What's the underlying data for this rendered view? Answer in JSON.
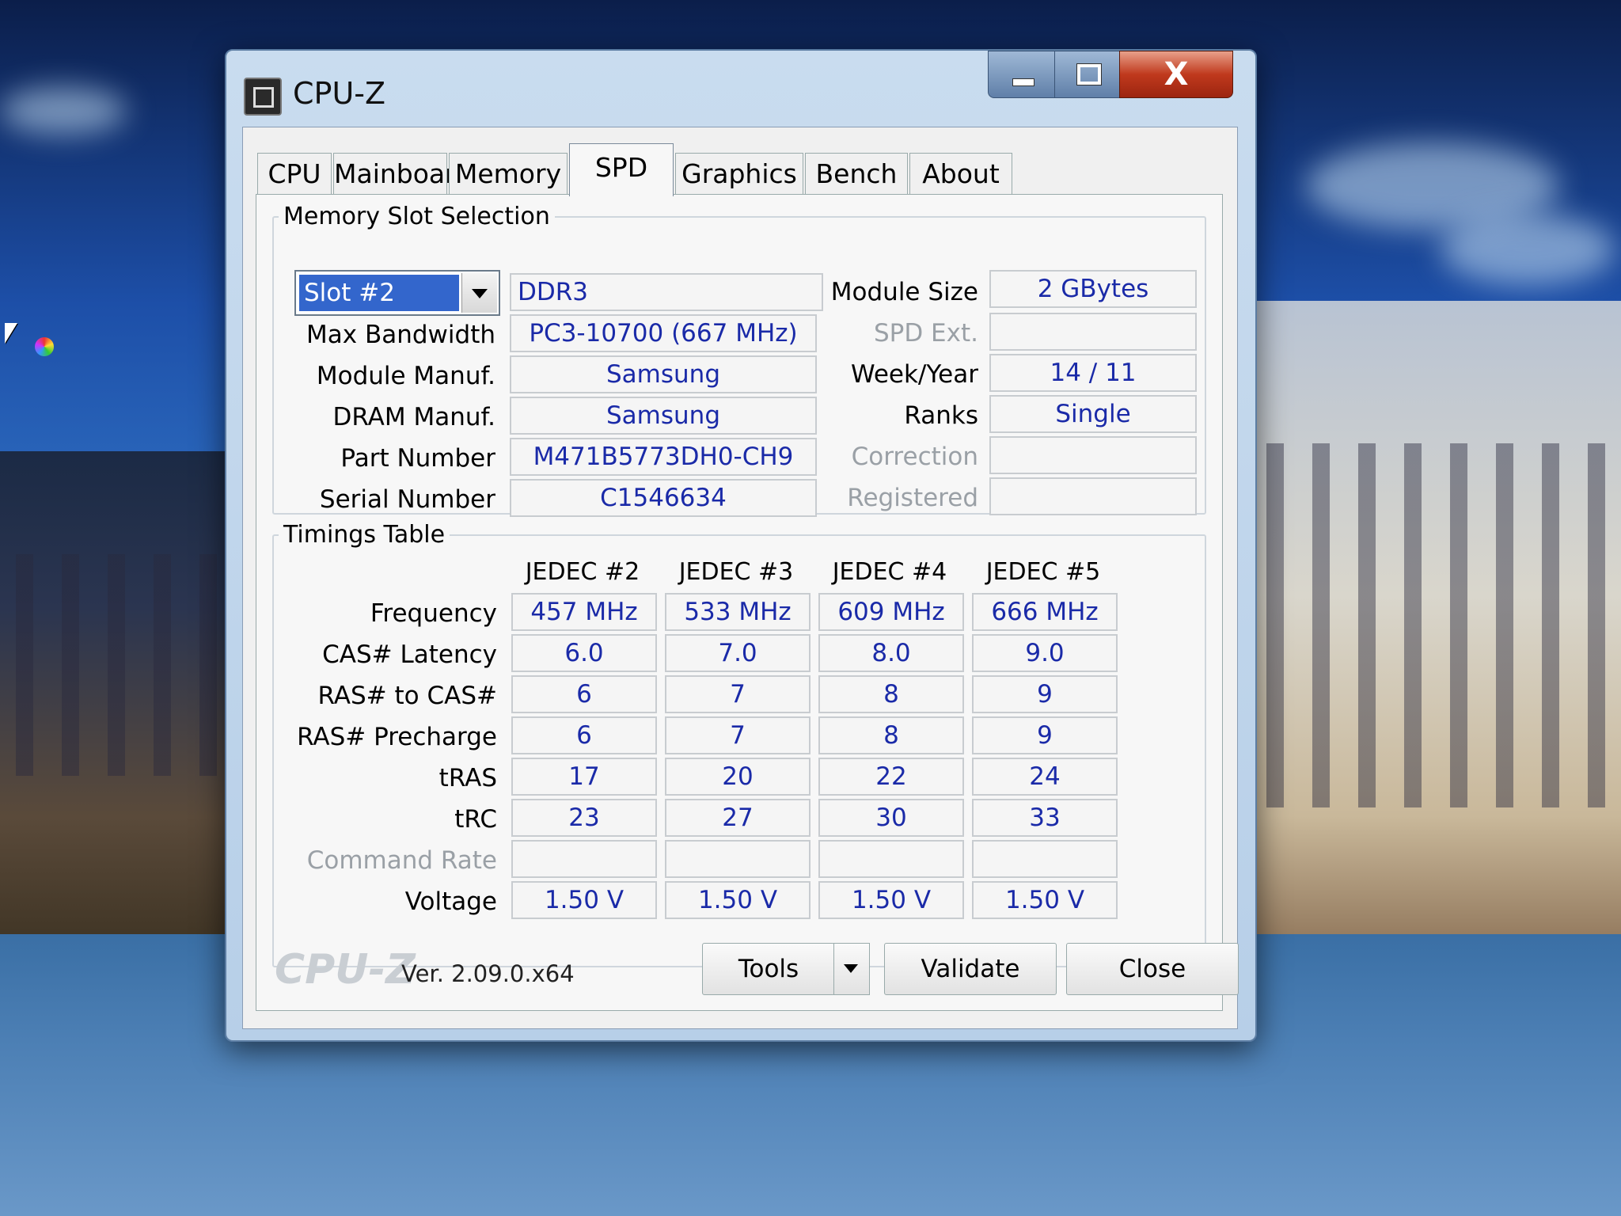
{
  "window": {
    "title": "CPU-Z",
    "close_glyph": "X"
  },
  "tabs": [
    {
      "label": "CPU"
    },
    {
      "label": "Mainboard"
    },
    {
      "label": "Memory"
    },
    {
      "label": "SPD"
    },
    {
      "label": "Graphics"
    },
    {
      "label": "Bench"
    },
    {
      "label": "About"
    }
  ],
  "slot": {
    "legend": "Memory Slot Selection",
    "selected": "Slot #2",
    "type": "DDR3",
    "module_size_label": "Module Size",
    "module_size": "2 GBytes",
    "max_bandwidth_label": "Max Bandwidth",
    "max_bandwidth": "PC3-10700 (667 MHz)",
    "spd_ext_label": "SPD Ext.",
    "spd_ext": "",
    "module_manuf_label": "Module Manuf.",
    "module_manuf": "Samsung",
    "week_year_label": "Week/Year",
    "week_year": "14 / 11",
    "dram_manuf_label": "DRAM Manuf.",
    "dram_manuf": "Samsung",
    "ranks_label": "Ranks",
    "ranks": "Single",
    "part_number_label": "Part Number",
    "part_number": "M471B5773DH0-CH9",
    "correction_label": "Correction",
    "correction": "",
    "serial_number_label": "Serial Number",
    "serial_number": "C1546634",
    "registered_label": "Registered",
    "registered": ""
  },
  "timings": {
    "legend": "Timings Table",
    "columns": [
      "JEDEC #2",
      "JEDEC #3",
      "JEDEC #4",
      "JEDEC #5"
    ],
    "rows": [
      {
        "label": "Frequency",
        "values": [
          "457 MHz",
          "533 MHz",
          "609 MHz",
          "666 MHz"
        ]
      },
      {
        "label": "CAS# Latency",
        "values": [
          "6.0",
          "7.0",
          "8.0",
          "9.0"
        ]
      },
      {
        "label": "RAS# to CAS#",
        "values": [
          "6",
          "7",
          "8",
          "9"
        ]
      },
      {
        "label": "RAS# Precharge",
        "values": [
          "6",
          "7",
          "8",
          "9"
        ]
      },
      {
        "label": "tRAS",
        "values": [
          "17",
          "20",
          "22",
          "24"
        ]
      },
      {
        "label": "tRC",
        "values": [
          "23",
          "27",
          "30",
          "33"
        ]
      },
      {
        "label": "Command Rate",
        "values": [
          "",
          "",
          "",
          ""
        ]
      },
      {
        "label": "Voltage",
        "values": [
          "1.50 V",
          "1.50 V",
          "1.50 V",
          "1.50 V"
        ]
      }
    ]
  },
  "footer": {
    "brand": "CPU-Z",
    "version": "Ver. 2.09.0.x64",
    "tools": "Tools",
    "validate": "Validate",
    "close": "Close"
  }
}
